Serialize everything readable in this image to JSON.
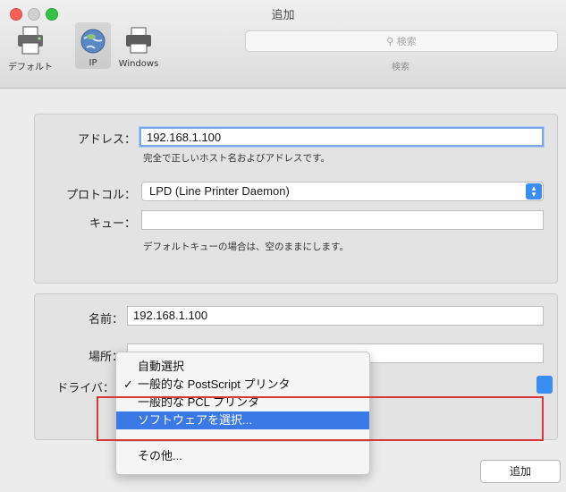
{
  "window": {
    "title": "追加"
  },
  "toolbar": {
    "default_label": "デフォルト",
    "ip_label": "IP",
    "windows_label": "Windows"
  },
  "search": {
    "placeholder": "検索",
    "caption": "検索"
  },
  "ip_panel": {
    "address_label": "アドレス：",
    "address_value": "192.168.1.100",
    "address_hint": "完全で正しいホスト名およびアドレスです。",
    "protocol_label": "プロトコル：",
    "protocol_value": "LPD (Line Printer Daemon)",
    "queue_label": "キュー：",
    "queue_value": "",
    "queue_hint": "デフォルトキューの場合は、空のままにします。"
  },
  "printer_panel": {
    "name_label": "名前：",
    "name_value": "192.168.1.100",
    "location_label": "場所：",
    "location_value": "",
    "driver_label": "ドライバ："
  },
  "driver_menu": {
    "items": [
      {
        "label": "自動選択",
        "checked": false,
        "selected": false
      },
      {
        "label": "一般的な PostScript プリンタ",
        "checked": true,
        "selected": false
      },
      {
        "label": "一般的な PCL プリンタ",
        "checked": false,
        "selected": false
      },
      {
        "label": "ソフトウェアを選択...",
        "checked": false,
        "selected": true
      },
      {
        "label": "その他...",
        "checked": false,
        "selected": false
      }
    ],
    "check_glyph": "✓"
  },
  "buttons": {
    "add_label": "追加"
  },
  "colors": {
    "accent": "#3b7ae6",
    "highlight_border": "#d9363e"
  }
}
